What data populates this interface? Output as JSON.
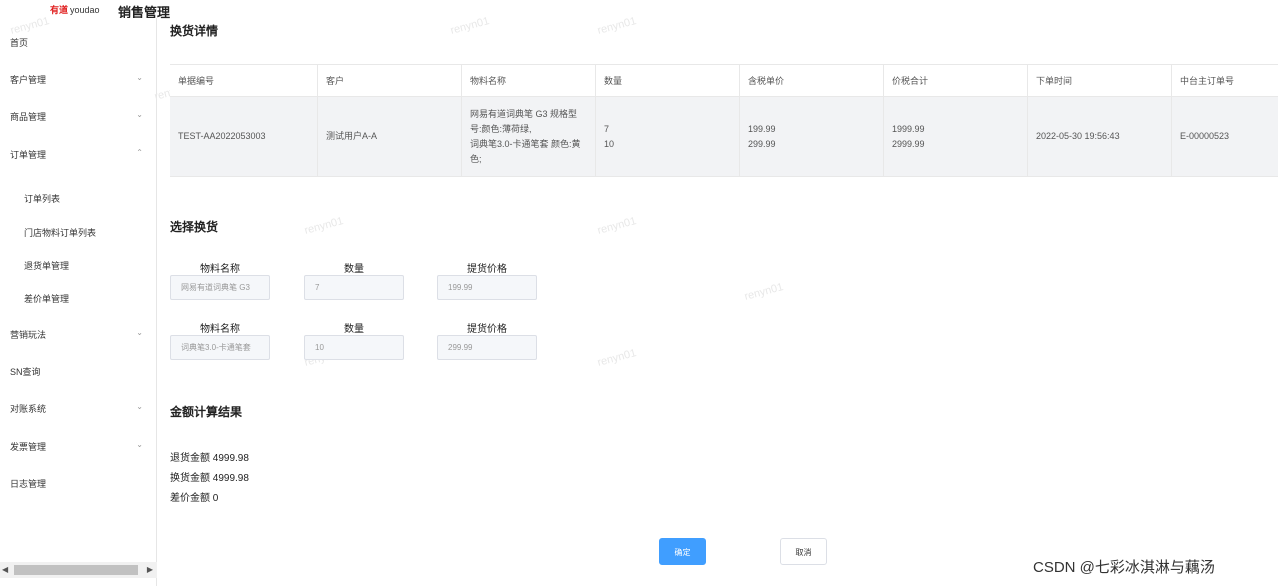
{
  "header": {
    "logo_brand": "有道",
    "logo_text": "youdao",
    "app_title": "销售管理"
  },
  "sidebar": {
    "items": [
      {
        "label": "首页"
      },
      {
        "label": "客户管理"
      },
      {
        "label": "商品管理"
      },
      {
        "label": "订单管理"
      },
      {
        "label": "订单列表"
      },
      {
        "label": "门店物料订单列表"
      },
      {
        "label": "退货单管理"
      },
      {
        "label": "差价单管理"
      },
      {
        "label": "营销玩法"
      },
      {
        "label": "SN查询"
      },
      {
        "label": "对账系统"
      },
      {
        "label": "发票管理"
      },
      {
        "label": "日志管理"
      }
    ]
  },
  "detail": {
    "title": "换货详情",
    "columns": [
      "单据编号",
      "客户",
      "物料名称",
      "数量",
      "含税单价",
      "价税合计",
      "下单时间",
      "中台主订单号"
    ],
    "row": {
      "order_no": "TEST-AA2022053003",
      "customer": "测试用户A-A",
      "material_line1": "网易有道词典笔 G3 规格型",
      "material_line2": "号:颜色:薄荷绿,",
      "material_line3": "词典笔3.0-卡通笔套 颜色:黄",
      "material_line4": "色;",
      "qty_1": "7",
      "qty_2": "10",
      "price_1": "199.99",
      "price_2": "299.99",
      "total_1": "1999.99",
      "total_2": "2999.99",
      "order_time": "2022-05-30 19:56:43",
      "main_order_no": "E-00000523"
    }
  },
  "exchange": {
    "title": "选择换货",
    "material_label": "物料名称",
    "qty_label": "数量",
    "price_label": "提货价格",
    "rows": [
      {
        "material": "网易有道词典笔 G3",
        "qty": "7",
        "price": "199.99"
      },
      {
        "material": "词典笔3.0-卡通笔套",
        "qty": "10",
        "price": "299.99"
      }
    ]
  },
  "result": {
    "title": "金额计算结果",
    "return_amount": "退货金额 4999.98",
    "exchange_amount": "换货金额 4999.98",
    "diff_amount": "差价金额 0"
  },
  "actions": {
    "confirm": "确定",
    "cancel": "取消"
  },
  "watermark": "renyn01",
  "footer_credit": "CSDN @七彩冰淇淋与藕汤",
  "colors": {
    "primary": "#409eff",
    "table_row_bg": "#f2f3f5",
    "input_bg": "#f5f7fa"
  }
}
